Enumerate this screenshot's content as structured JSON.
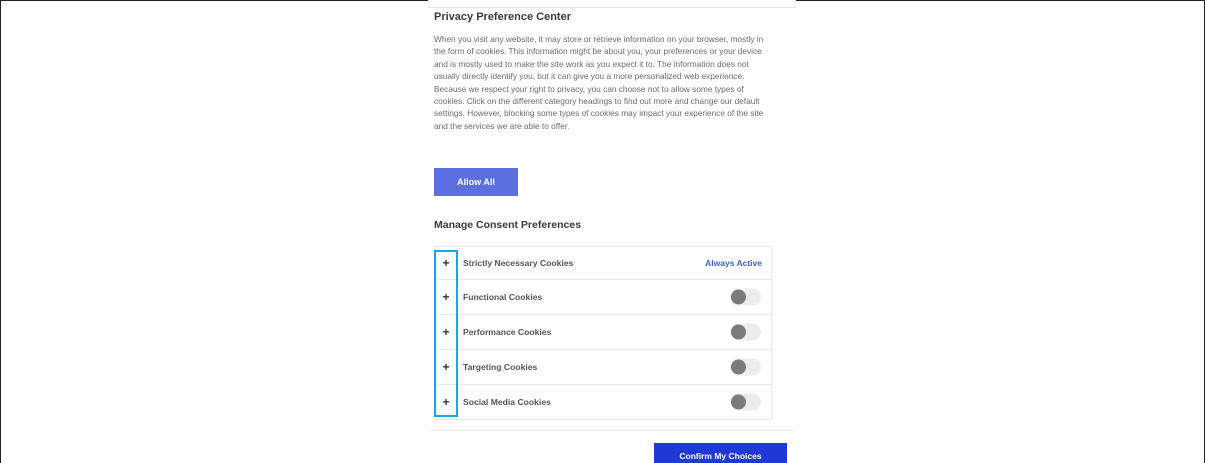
{
  "header": {
    "title": "Privacy Preference Center"
  },
  "description": "When you visit any website, it may store or retrieve information on your browser, mostly in the form of cookies. This information might be about you, your preferences or your device and is mostly used to make the site work as you expect it to. The information does not usually directly identify you, but it can give you a more personalized web experience. Because we respect your right to privacy, you can choose not to allow some types of cookies. Click on the different category headings to find out more and change our default settings. However, blocking some types of cookies may impact your experience of the site and the services we are able to offer.",
  "actions": {
    "allow_all": "Allow All",
    "confirm": "Confirm My Choices"
  },
  "manage": {
    "title": "Manage Consent Preferences",
    "expand_glyph": "+",
    "categories": [
      {
        "label": "Strictly Necessary Cookies",
        "status": "Always Active"
      },
      {
        "label": "Functional Cookies",
        "toggle": "off"
      },
      {
        "label": "Performance Cookies",
        "toggle": "off"
      },
      {
        "label": "Targeting Cookies",
        "toggle": "off"
      },
      {
        "label": "Social Media Cookies",
        "toggle": "off"
      }
    ]
  },
  "colors": {
    "primary_button": "#5b6fe0",
    "confirm_button": "#1f39d6",
    "link_text": "#3a62c9",
    "highlight": "#1aa5e8"
  }
}
